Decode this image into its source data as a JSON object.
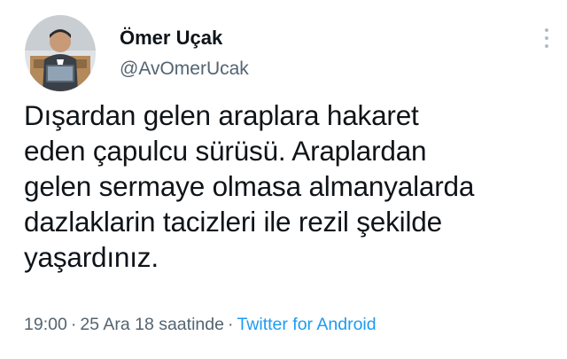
{
  "author": {
    "display_name": "Ömer Uçak",
    "handle": "@AvOmerUcak",
    "avatar_icon": "profile-photo-avatar"
  },
  "more_icon": "more-vertical-icon",
  "tweet": {
    "lines": [
      "Dışardan gelen araplara hakaret",
      "eden çapulcu sürüsü. Araplardan",
      "gelen sermaye olmasa almanyalarda",
      "dazlaklarin tacizleri ile rezil şekilde",
      "yaşardınız."
    ]
  },
  "meta": {
    "time": "19:00",
    "separator": "·",
    "date": "25 Ara 18 saatinde",
    "source": "Twitter for Android"
  },
  "colors": {
    "text": "#0f1419",
    "secondary": "#536471",
    "link": "#1d9bf0"
  }
}
